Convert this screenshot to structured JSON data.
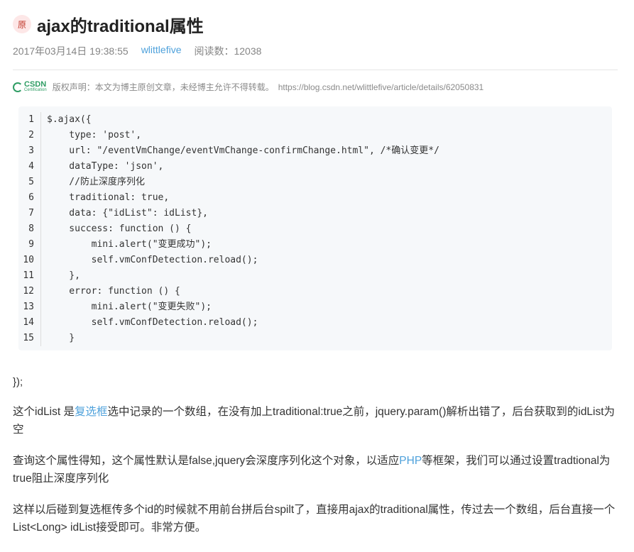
{
  "header": {
    "badge": "原",
    "title": "ajax的traditional属性"
  },
  "meta": {
    "date": "2017年03月14日 19:38:55",
    "author": "wlittlefive",
    "reads": "阅读数：12038"
  },
  "copyright": {
    "logo_text": "CSDN",
    "logo_sub": "Certification",
    "text": "版权声明：本文为博主原创文章，未经博主允许不得转载。",
    "url": "https://blog.csdn.net/wlittlefive/article/details/62050831"
  },
  "code": {
    "lines": [
      {
        "n": "1",
        "t": "$.ajax({"
      },
      {
        "n": "2",
        "t": "    type: 'post',"
      },
      {
        "n": "3",
        "t": "    url: \"/eventVmChange/eventVmChange-confirmChange.html\", /*确认变更*/"
      },
      {
        "n": "4",
        "t": "    dataType: 'json',"
      },
      {
        "n": "5",
        "t": "    //防止深度序列化"
      },
      {
        "n": "6",
        "t": "    traditional: true,"
      },
      {
        "n": "7",
        "t": "    data: {\"idList\": idList},"
      },
      {
        "n": "8",
        "t": "    success: function () {"
      },
      {
        "n": "9",
        "t": "        mini.alert(\"变更成功\");"
      },
      {
        "n": "10",
        "t": "        self.vmConfDetection.reload();"
      },
      {
        "n": "11",
        "t": "    },"
      },
      {
        "n": "12",
        "t": "    error: function () {"
      },
      {
        "n": "13",
        "t": "        mini.alert(\"变更失败\");"
      },
      {
        "n": "14",
        "t": "        self.vmConfDetection.reload();"
      },
      {
        "n": "15",
        "t": "    }"
      }
    ]
  },
  "body": {
    "tail": "});",
    "p1_a": "这个idList 是",
    "p1_link": "复选框",
    "p1_b": "选中记录的一个数组，在没有加上traditional:true之前，jquery.param()解析出错了，后台获取到的idList为空",
    "p2_a": "查询这个属性得知，这个属性默认是false,jquery会深度序列化这个对象，以适应",
    "p2_link": "PHP",
    "p2_b": "等框架，我们可以通过设置tradtional为true阻止深度序列化",
    "p3": "这样以后碰到复选框传多个id的时候就不用前台拼后台spilt了，直接用ajax的traditional属性，传过去一个数组，后台直接一个List<Long> idList接受即可。非常方便。"
  }
}
